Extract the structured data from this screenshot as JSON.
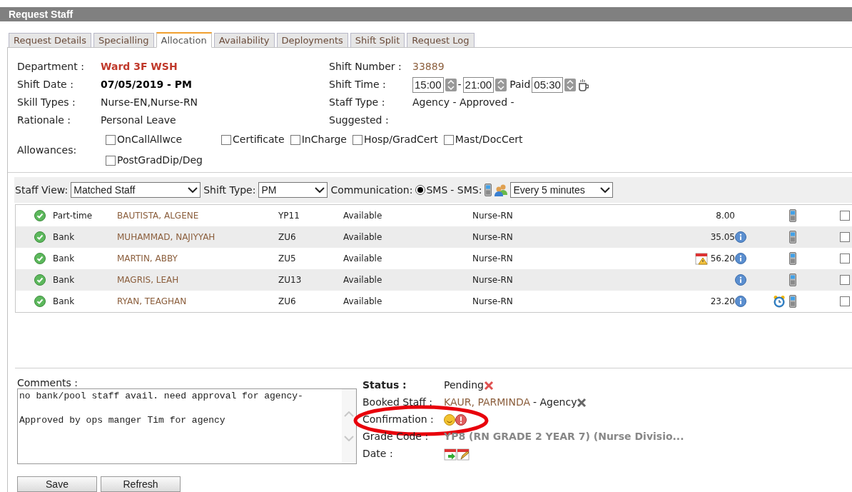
{
  "window": {
    "title": "Request Staff"
  },
  "tabs": [
    {
      "label": "Request Details",
      "selected": false
    },
    {
      "label": "Specialling",
      "selected": false
    },
    {
      "label": "Allocation",
      "selected": true
    },
    {
      "label": "Availability",
      "selected": false
    },
    {
      "label": "Deployments",
      "selected": false
    },
    {
      "label": "Shift Split",
      "selected": false
    },
    {
      "label": "Request Log",
      "selected": false
    }
  ],
  "details": {
    "department": {
      "label": "Department :",
      "value": "Ward 3F WSH"
    },
    "shift_date": {
      "label": "Shift Date :",
      "value": "07/05/2019 - PM"
    },
    "skill_types": {
      "label": "Skill Types :",
      "value": "Nurse-EN,Nurse-RN"
    },
    "rationale": {
      "label": "Rationale :",
      "value": "Personal Leave"
    },
    "shift_number": {
      "label": "Shift Number :",
      "value": "33889"
    },
    "shift_time": {
      "label": "Shift Time :",
      "start": "15:00",
      "separator": "-",
      "end": "21:00",
      "paid_label": "Paid",
      "paid": "05:30"
    },
    "staff_type": {
      "label": "Staff Type :",
      "value": "Agency - Approved -"
    },
    "suggested": {
      "label": "Suggested :"
    }
  },
  "allowances": {
    "label": "Allowances:",
    "items": [
      {
        "label": "OnCallAllwce",
        "checked": false
      },
      {
        "label": "Certificate",
        "checked": false
      },
      {
        "label": "InCharge",
        "checked": false
      },
      {
        "label": "Hosp/GradCert",
        "checked": false
      },
      {
        "label": "Mast/DocCert",
        "checked": false
      },
      {
        "label": "PostGradDip/Deg",
        "checked": false
      }
    ]
  },
  "toolbar": {
    "staff_view": {
      "label": "Staff View:",
      "value": "Matched Staff"
    },
    "shift_type": {
      "label": "Shift Type:",
      "value": "PM"
    },
    "communication": {
      "label": "Communication:",
      "option": "SMS",
      "selected": true,
      "suffix": "- SMS:",
      "frequency": "Every 5 minutes"
    }
  },
  "staff": [
    {
      "type": "Part-time",
      "name": "BAUTISTA, ALGENE",
      "code": "YP11",
      "availability": "Available",
      "skill": "Nurse-RN",
      "hours": "8.00",
      "info": false,
      "calendar_warning": false,
      "alarm": false,
      "checked": false
    },
    {
      "type": "Bank",
      "name": "MUHAMMAD, NAJIYYAH",
      "code": "ZU6",
      "availability": "Available",
      "skill": "Nurse-RN",
      "hours": "35.05",
      "info": true,
      "calendar_warning": false,
      "alarm": false,
      "checked": false
    },
    {
      "type": "Bank",
      "name": "MARTIN, ABBY",
      "code": "ZU5",
      "availability": "Available",
      "skill": "Nurse-RN",
      "hours": "56.20",
      "info": true,
      "calendar_warning": true,
      "alarm": false,
      "checked": false
    },
    {
      "type": "Bank",
      "name": "MAGRIS, LEAH",
      "code": "ZU13",
      "availability": "Available",
      "skill": "Nurse-RN",
      "info": true,
      "calendar_warning": false,
      "alarm": false,
      "checked": false
    },
    {
      "type": "Bank",
      "name": "RYAN, TEAGHAN",
      "code": "ZU6",
      "availability": "Available",
      "skill": "Nurse-RN",
      "hours": "23.20",
      "info": true,
      "calendar_warning": false,
      "alarm": true,
      "checked": false
    }
  ],
  "comments": {
    "label": "Comments :",
    "text": "no bank/pool staff avail. need approval for agency-\n\nApproved by ops manger Tim for agency"
  },
  "booking": {
    "status": {
      "label": "Status :",
      "value": "Pending"
    },
    "booked_staff": {
      "label": "Booked Staff :",
      "name": "KAUR, PARMINDA",
      "suffix": "- Agency"
    },
    "confirmation": {
      "label": "Confirmation :"
    },
    "grade_code": {
      "label": "Grade Code :",
      "value": "YP8 (RN GRADE 2 YEAR 7) (Nurse Divisio..."
    },
    "date": {
      "label": "Date :"
    }
  },
  "buttons": [
    "Save",
    "Refresh"
  ]
}
